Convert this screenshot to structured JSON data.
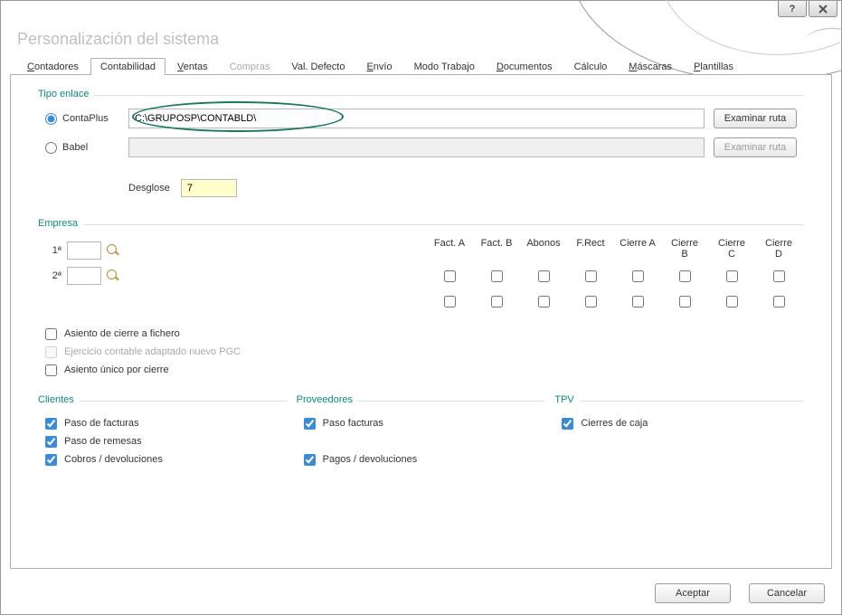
{
  "window": {
    "title": "Personalización del sistema"
  },
  "tabs": {
    "contadores": "Contadores",
    "contabilidad": "Contabilidad",
    "ventas": "Ventas",
    "compras": "Compras",
    "valdefecto": "Val. Defecto",
    "envio": "Envío",
    "modotrabajo": "Modo Trabajo",
    "documentos": "Documentos",
    "calculo": "Cálculo",
    "mascaras": "Máscaras",
    "plantillas": "Plantillas"
  },
  "tipo_enlace": {
    "legend": "Tipo enlace",
    "contaplus_label": "ContaPlus",
    "contaplus_path": "C:\\GRUPOSP\\CONTABLD\\",
    "babel_label": "Babel",
    "babel_path": "",
    "examinar_ruta": "Examinar ruta",
    "desglose_label": "Desglose",
    "desglose_value": "7"
  },
  "empresa": {
    "legend": "Empresa",
    "row1_label": "1ª",
    "row2_label": "2ª",
    "headers": {
      "factA": "Fact. A",
      "factB": "Fact. B",
      "abonos": "Abonos",
      "frect": "F.Rect",
      "cierreA": "Cierre A",
      "cierreB": "Cierre B",
      "cierreC": "Cierre C",
      "cierreD": "Cierre D"
    },
    "asiento_cierre_fichero": "Asiento de cierre a fichero",
    "ejercicio_pgc": "Ejercicio contable adaptado nuevo PGC",
    "asiento_unico": "Asiento único por cierre"
  },
  "clientes": {
    "legend": "Clientes",
    "paso_facturas": "Paso de facturas",
    "paso_remesas": "Paso de remesas",
    "cobros_dev": "Cobros / devoluciones"
  },
  "proveedores": {
    "legend": "Proveedores",
    "paso_facturas": "Paso facturas",
    "pagos_dev": "Pagos / devoluciones"
  },
  "tpv": {
    "legend": "TPV",
    "cierres_caja": "Cierres de caja"
  },
  "footer": {
    "aceptar": "Aceptar",
    "cancelar": "Cancelar"
  }
}
